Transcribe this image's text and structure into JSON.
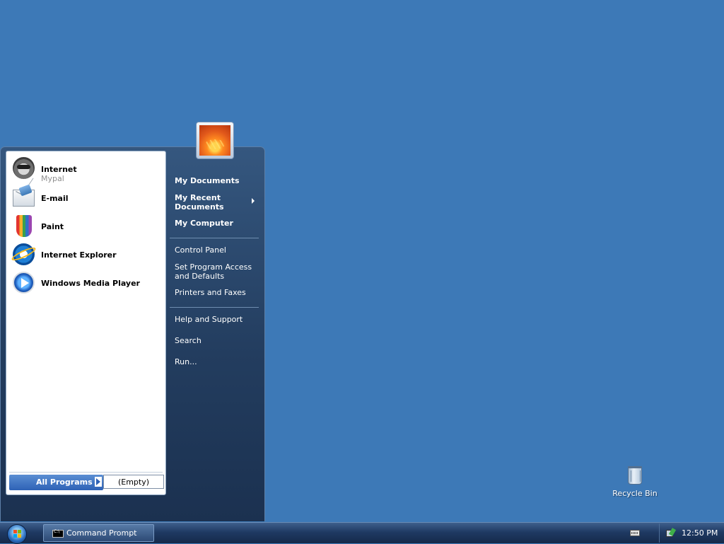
{
  "start_menu": {
    "pinned": [
      {
        "label": "Internet",
        "sublabel": "Mypal",
        "icon": "raccoon-browser-icon"
      },
      {
        "label": "E-mail",
        "icon": "envelope-icon"
      }
    ],
    "recent": [
      {
        "label": "Paint",
        "icon": "paint-brushes-icon"
      },
      {
        "label": "Internet Explorer",
        "icon": "internet-explorer-icon"
      },
      {
        "label": "Windows Media Player",
        "icon": "media-player-icon"
      }
    ],
    "all_programs": {
      "label": "All Programs",
      "empty_label": "(Empty)"
    },
    "right": {
      "my_documents": "My Documents",
      "my_recent_documents": "My Recent Documents",
      "my_computer": "My Computer",
      "control_panel": "Control Panel",
      "set_program_access": "Set Program Access and Defaults",
      "printers_faxes": "Printers and Faxes",
      "help_support": "Help and Support",
      "search": "Search",
      "run": "Run..."
    }
  },
  "desktop": {
    "recycle_bin": "Recycle Bin"
  },
  "taskbar": {
    "task": "Command Prompt",
    "clock": "12:50 PM"
  },
  "colors": {
    "desktop": "#3d79b7",
    "menu_right": "#233d5f",
    "all_programs": "#2e62b6"
  }
}
